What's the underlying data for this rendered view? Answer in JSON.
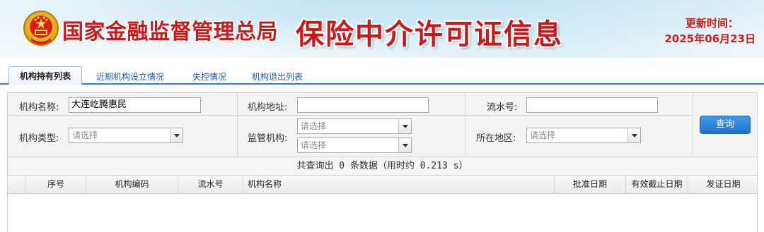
{
  "header": {
    "agency_name": "国家金融监督管理总局",
    "site_title": "保险中介许可证信息",
    "update_label": "更新时间：",
    "update_date": "2025年06月23日",
    "emblem_icon": "national-emblem-icon",
    "accent_color": "#c81b1b"
  },
  "tabs": [
    {
      "label": "机构持有列表",
      "active": true
    },
    {
      "label": "近期机构设立情况",
      "active": false
    },
    {
      "label": "失控情况",
      "active": false
    },
    {
      "label": "机构退出列表",
      "active": false
    }
  ],
  "search": {
    "org_name_label": "机构名称:",
    "org_name_value": "大连屹腾惠民",
    "org_address_label": "机构地址:",
    "org_address_value": "",
    "serial_label": "流水号:",
    "serial_value": "",
    "org_type_label": "机构类型:",
    "org_type_value": "请选择",
    "regulator_label": "监管机构:",
    "regulator_value_1": "请选择",
    "regulator_value_2": "请选择",
    "region_label": "所在地区:",
    "region_value": "请选择",
    "query_button": "查询",
    "button_color": "#2a86dc"
  },
  "result": {
    "summary": "共查询出 0 条数据（用时约 0.213 s）",
    "count": 0,
    "elapsed_seconds": 0.213
  },
  "table": {
    "columns": [
      "序号",
      "机构编码",
      "流水号",
      "机构名称",
      "批准日期",
      "有效截止日期",
      "发证日期"
    ],
    "rows": []
  }
}
